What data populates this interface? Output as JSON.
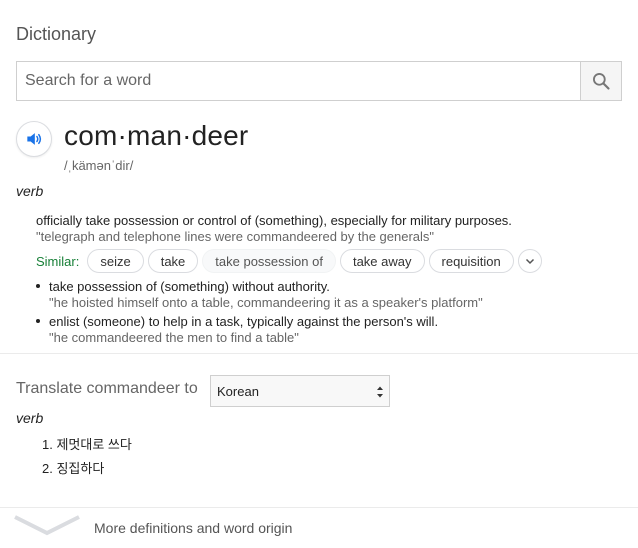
{
  "header": {
    "title": "Dictionary"
  },
  "search": {
    "placeholder": "Search for a word",
    "value": ""
  },
  "entry": {
    "word": "com·man·deer",
    "phonetic": "/ˌkämənˈdir/",
    "part_of_speech": "verb",
    "main_definition": {
      "text": "officially take possession or control of (something), especially for military purposes.",
      "example": "\"telegraph and telephone lines were commandeered by the generals\""
    },
    "similar": {
      "label": "Similar:",
      "words": [
        "seize",
        "take",
        "take possession of",
        "take away",
        "requisition"
      ]
    },
    "sub_definitions": [
      {
        "text": "take possession of (something) without authority.",
        "example": "\"he hoisted himself onto a table, commandeering it as a speaker's platform\""
      },
      {
        "text": "enlist (someone) to help in a task, typically against the person's will.",
        "example": "\"he commandeered the men to find a table\""
      }
    ]
  },
  "translate": {
    "label": "Translate commandeer to",
    "language": "Korean",
    "part_of_speech": "verb",
    "items": [
      "1. 제멋대로 쓰다",
      "2. 징집하다"
    ]
  },
  "footer": {
    "more_label": "More definitions and word origin"
  },
  "colors": {
    "similar_label": "#188038",
    "speaker_icon": "#1a73e8",
    "divider": "#ebebeb"
  },
  "icons": {
    "search": "search-icon",
    "speaker": "speaker-icon",
    "expand": "chevron-down-icon",
    "more": "chevron-down-icon"
  }
}
